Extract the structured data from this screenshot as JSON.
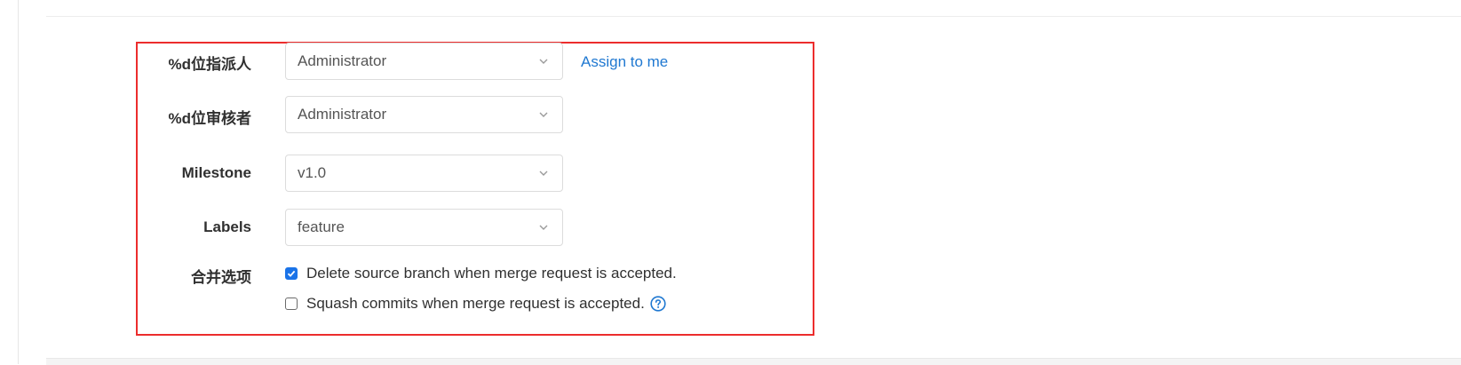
{
  "form": {
    "assignees": {
      "label": "%d位指派人",
      "value": "Administrator",
      "assign_to_me": "Assign to me"
    },
    "reviewers": {
      "label": "%d位审核者",
      "value": "Administrator"
    },
    "milestone": {
      "label": "Milestone",
      "value": "v1.0"
    },
    "labels": {
      "label": "Labels",
      "value": "feature"
    },
    "merge_options": {
      "label": "合并选项",
      "delete_source_branch": {
        "text": "Delete source branch when merge request is accepted.",
        "checked": true
      },
      "squash_commits": {
        "text": "Squash commits when merge request is accepted.",
        "checked": false
      }
    }
  },
  "colors": {
    "highlight_border": "#ec2d2d",
    "link": "#1f78d1",
    "checkbox_checked": "#1a73e8",
    "help_icon": "#1f78d1"
  },
  "icons": {
    "dropdown": "chevron-down-icon",
    "help": "question-circle-icon",
    "check": "checkmark-icon"
  }
}
